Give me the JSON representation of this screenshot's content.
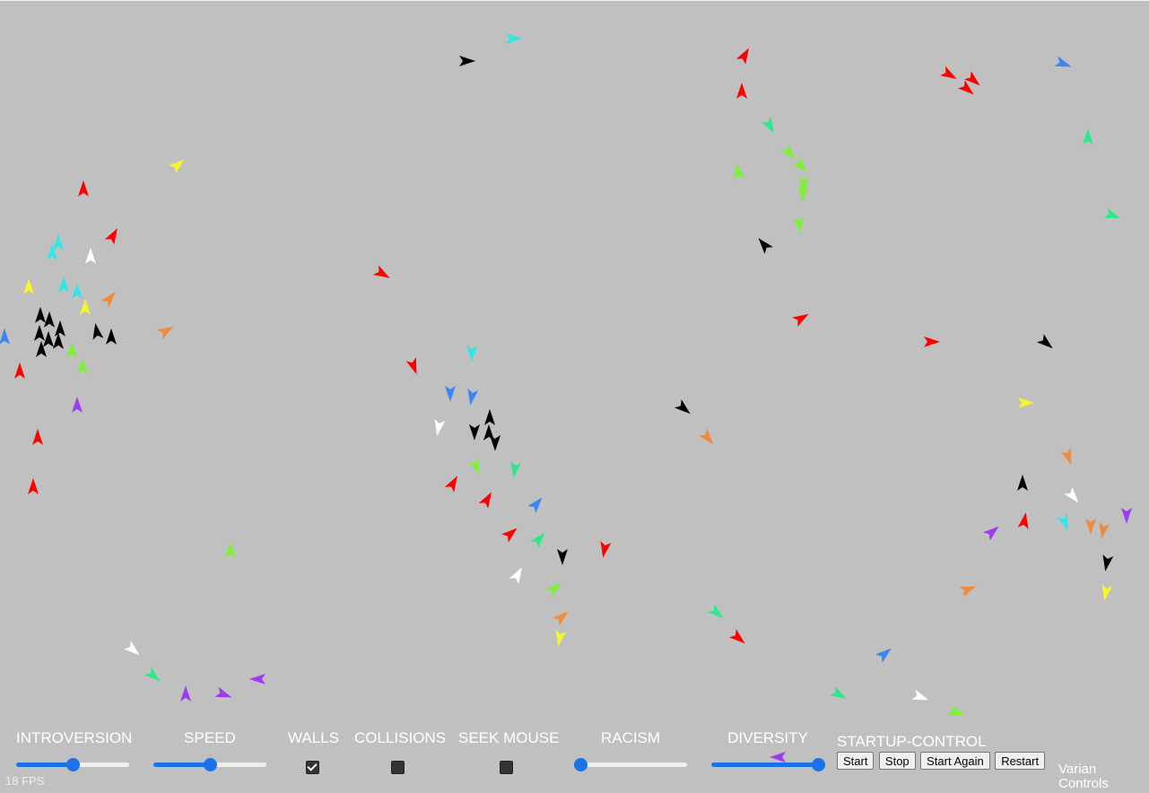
{
  "fps_text": "18 FPS",
  "controls": {
    "introversion": {
      "label": "INTROVERSION",
      "value": 0.5
    },
    "speed": {
      "label": "SPEED",
      "value": 0.5
    },
    "walls": {
      "label": "WALLS",
      "checked": true
    },
    "collisions": {
      "label": "COLLISIONS",
      "checked": false
    },
    "seek_mouse": {
      "label": "SEEK MOUSE",
      "checked": false
    },
    "racism": {
      "label": "RACISM",
      "value": 0.0
    },
    "diversity": {
      "label": "DIVERSITY",
      "value": 1.0
    }
  },
  "startup": {
    "label": "STARTUP-CONTROL",
    "start": "Start",
    "stop": "Stop",
    "start_again": "Start Again",
    "restart": "Restart"
  },
  "varian_label": "Varian Controls",
  "colors": {
    "background": "#c0c0c0",
    "slider_accent": "#1a73e8",
    "red": "#ff0000",
    "black": "#000000",
    "cyan": "#33e6e6",
    "blue": "#3d85f0",
    "white": "#ffffff",
    "yellow": "#f5f52a",
    "orange": "#f08a3c",
    "green": "#7ff03a",
    "teal": "#30e88a",
    "purple": "#9b3cf0"
  },
  "boids": [
    [
      "cyan",
      572,
      43,
      0
    ],
    [
      "black",
      520,
      68,
      0
    ],
    [
      "red",
      830,
      62,
      -60
    ],
    [
      "red",
      827,
      102,
      -90
    ],
    [
      "teal",
      858,
      140,
      60
    ],
    [
      "green",
      880,
      170,
      50
    ],
    [
      "green",
      893,
      185,
      50
    ],
    [
      "green",
      896,
      205,
      90
    ],
    [
      "green",
      895,
      215,
      90
    ],
    [
      "green",
      823,
      192,
      -100
    ],
    [
      "green",
      891,
      250,
      80
    ],
    [
      "black",
      852,
      273,
      -130
    ],
    [
      "red",
      1058,
      83,
      30
    ],
    [
      "red",
      1085,
      89,
      40
    ],
    [
      "red",
      1078,
      99,
      40
    ],
    [
      "blue",
      1185,
      71,
      20
    ],
    [
      "teal",
      1213,
      153,
      -90
    ],
    [
      "teal",
      1240,
      240,
      20
    ],
    [
      "yellow",
      198,
      184,
      -40
    ],
    [
      "red",
      93,
      211,
      -90
    ],
    [
      "red",
      126,
      263,
      -60
    ],
    [
      "cyan",
      65,
      271,
      -90
    ],
    [
      "cyan",
      58,
      282,
      -90
    ],
    [
      "white",
      101,
      286,
      -90
    ],
    [
      "yellow",
      32,
      320,
      -90
    ],
    [
      "cyan",
      71,
      318,
      -90
    ],
    [
      "cyan",
      86,
      325,
      -90
    ],
    [
      "orange",
      122,
      333,
      -50
    ],
    [
      "yellow",
      95,
      343,
      -90
    ],
    [
      "black",
      45,
      352,
      -90
    ],
    [
      "black",
      55,
      357,
      -90
    ],
    [
      "black",
      67,
      367,
      -90
    ],
    [
      "black",
      44,
      372,
      -90
    ],
    [
      "black",
      54,
      379,
      -90
    ],
    [
      "black",
      65,
      381,
      -90
    ],
    [
      "black",
      46,
      390,
      -90
    ],
    [
      "black",
      108,
      370,
      -100
    ],
    [
      "black",
      124,
      376,
      -90
    ],
    [
      "blue",
      5,
      376,
      -90
    ],
    [
      "green",
      80,
      391,
      -90
    ],
    [
      "green",
      92,
      409,
      -90
    ],
    [
      "red",
      22,
      414,
      -90
    ],
    [
      "purple",
      86,
      452,
      -90
    ],
    [
      "red",
      42,
      488,
      -90
    ],
    [
      "red",
      37,
      543,
      -90
    ],
    [
      "orange",
      185,
      369,
      -30
    ],
    [
      "red",
      426,
      305,
      30
    ],
    [
      "red",
      461,
      408,
      70
    ],
    [
      "cyan",
      526,
      393,
      90
    ],
    [
      "blue",
      502,
      438,
      90
    ],
    [
      "blue",
      526,
      442,
      100
    ],
    [
      "white",
      489,
      476,
      100
    ],
    [
      "black",
      546,
      466,
      -90
    ],
    [
      "black",
      529,
      481,
      90
    ],
    [
      "black",
      545,
      483,
      -90
    ],
    [
      "black",
      552,
      493,
      90
    ],
    [
      "green",
      531,
      520,
      70
    ],
    [
      "teal",
      574,
      523,
      100
    ],
    [
      "red",
      505,
      539,
      -60
    ],
    [
      "red",
      543,
      557,
      -60
    ],
    [
      "blue",
      598,
      562,
      -50
    ],
    [
      "red",
      569,
      595,
      -40
    ],
    [
      "teal",
      601,
      601,
      -50
    ],
    [
      "black",
      627,
      620,
      90
    ],
    [
      "red",
      674,
      612,
      100
    ],
    [
      "white",
      577,
      641,
      -60
    ],
    [
      "green",
      618,
      656,
      -40
    ],
    [
      "orange",
      626,
      688,
      -40
    ],
    [
      "yellow",
      624,
      711,
      100
    ],
    [
      "red",
      893,
      355,
      -30
    ],
    [
      "red",
      1038,
      381,
      0
    ],
    [
      "black",
      1166,
      382,
      40
    ],
    [
      "yellow",
      1143,
      449,
      0
    ],
    [
      "black",
      762,
      455,
      40
    ],
    [
      "orange",
      789,
      488,
      50
    ],
    [
      "orange",
      1191,
      509,
      70
    ],
    [
      "black",
      1140,
      539,
      -90
    ],
    [
      "white",
      1196,
      553,
      50
    ],
    [
      "cyan",
      1187,
      582,
      70
    ],
    [
      "red",
      1142,
      581,
      -80
    ],
    [
      "orange",
      1216,
      586,
      90
    ],
    [
      "orange",
      1230,
      591,
      100
    ],
    [
      "purple",
      1256,
      574,
      90
    ],
    [
      "purple",
      1106,
      593,
      -40
    ],
    [
      "black",
      1234,
      627,
      100
    ],
    [
      "orange",
      1079,
      657,
      -20
    ],
    [
      "yellow",
      1233,
      660,
      100
    ],
    [
      "green",
      257,
      614,
      -90
    ],
    [
      "white",
      148,
      724,
      40
    ],
    [
      "teal",
      171,
      753,
      40
    ],
    [
      "purple",
      207,
      774,
      -90
    ],
    [
      "purple",
      249,
      774,
      20
    ],
    [
      "purple",
      288,
      757,
      180
    ],
    [
      "teal",
      799,
      683,
      40
    ],
    [
      "red",
      823,
      711,
      40
    ],
    [
      "blue",
      986,
      729,
      -40
    ],
    [
      "teal",
      935,
      774,
      30
    ],
    [
      "white",
      1026,
      777,
      20
    ],
    [
      "green",
      1066,
      794,
      20
    ],
    [
      "purple",
      868,
      844,
      180
    ]
  ]
}
